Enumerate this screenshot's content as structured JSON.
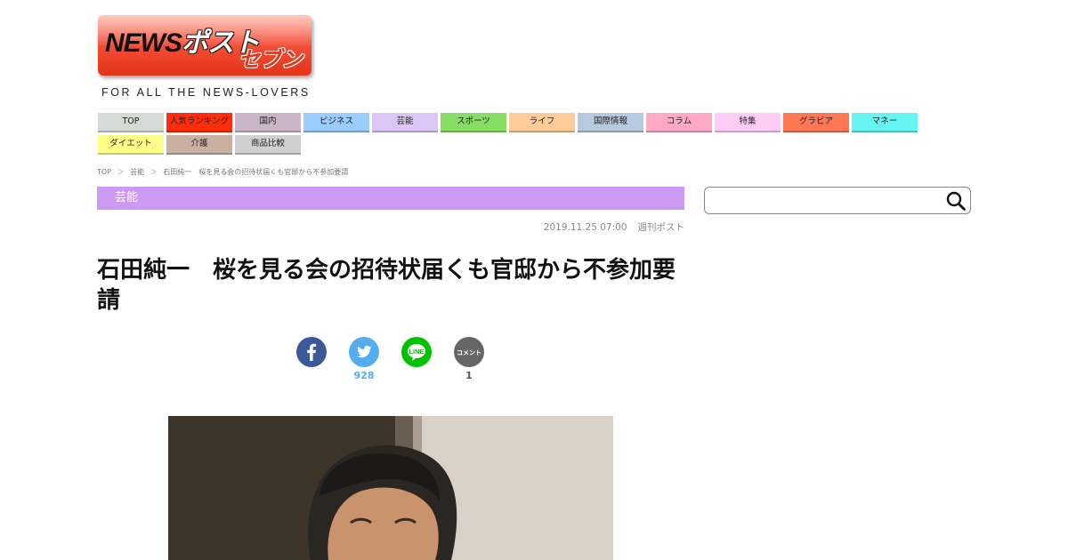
{
  "logo": {
    "main_latin": "NEWS",
    "main_kana": "ポスト",
    "sub": "セブン",
    "tagline": "FOR ALL THE NEWS-LOVERS"
  },
  "nav": {
    "items": [
      {
        "label": "TOP",
        "color": "#d6dad4"
      },
      {
        "label": "人気ランキング",
        "color": "#ff2d0b"
      },
      {
        "label": "国内",
        "color": "#c9b6c8"
      },
      {
        "label": "ビジネス",
        "color": "#99ccff"
      },
      {
        "label": "芸能",
        "color": "#dcc6f5"
      },
      {
        "label": "スポーツ",
        "color": "#88dd66"
      },
      {
        "label": "ライフ",
        "color": "#ffcc99"
      },
      {
        "label": "国際情報",
        "color": "#b8c8de"
      },
      {
        "label": "コラム",
        "color": "#ffa9c5"
      },
      {
        "label": "特集",
        "color": "#ffccf5"
      },
      {
        "label": "グラビア",
        "color": "#ff7755"
      },
      {
        "label": "マネー",
        "color": "#66f5f0"
      },
      {
        "label": "ダイエット",
        "color": "#ffff88"
      },
      {
        "label": "介護",
        "color": "#c9b0a0"
      },
      {
        "label": "商品比較",
        "color": "#d0d0d0"
      }
    ]
  },
  "breadcrumb": {
    "items": [
      "TOP",
      "芸能",
      "石田純一　桜を見る会の招待状届くも官邸から不参加要請"
    ],
    "separator": "＞"
  },
  "category": {
    "label": "芸能",
    "color": "#cc99f5"
  },
  "article": {
    "date": "2019.11.25 07:00",
    "source": "週刊ポスト",
    "title": "石田純一　桜を見る会の招待状届くも官邸から不参加要請"
  },
  "share": {
    "facebook": {
      "icon": "facebook-icon",
      "color": "#3b5998"
    },
    "twitter": {
      "icon": "twitter-icon",
      "color": "#55acee",
      "count": "928"
    },
    "line": {
      "icon": "line-icon",
      "color": "#00c300",
      "label": "LINE"
    },
    "comment": {
      "icon": "comment-icon",
      "color": "#666666",
      "label": "コメント",
      "count": "1"
    }
  },
  "search": {
    "placeholder": ""
  }
}
